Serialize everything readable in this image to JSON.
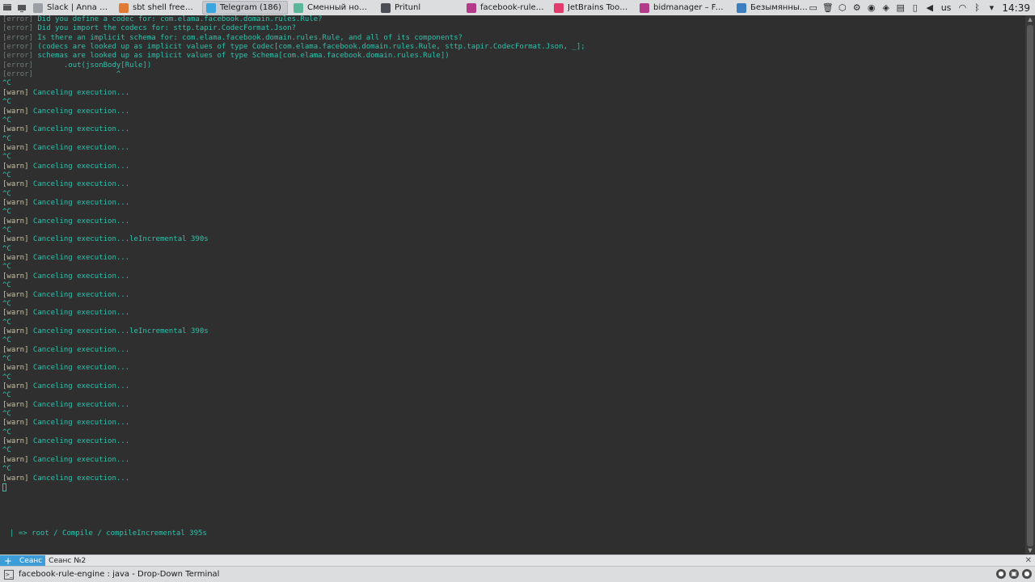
{
  "taskbar": {
    "tasks": [
      {
        "label": "Slack | Anna Pono…",
        "color": "#9aa0a6"
      },
      {
        "label": "sbt shell freeze …",
        "color": "#e07a35"
      },
      {
        "label": "Telegram (186)",
        "color": "#3aa6dd"
      },
      {
        "label": "Сменный носител…",
        "color": "#5bb69a"
      },
      {
        "label": "Pritunl",
        "color": "#4b4f55"
      },
      {
        "label": "facebook-rule-engi…",
        "color": "#b43a8a"
      },
      {
        "label": "JetBrains Toolbox",
        "color": "#e53b6b"
      },
      {
        "label": "bidmanager – Face…",
        "color": "#b43a8a"
      },
      {
        "label": "Безымянный* — S…",
        "color": "#3c7fc1"
      }
    ],
    "lang": "us",
    "clock": "14:39"
  },
  "terminal": {
    "error_lines": [
      {
        "tag": "[error]",
        "text": " Did you define a codec for: com.elama.facebook.domain.rules.Rule?"
      },
      {
        "tag": "[error]",
        "text": " Did you import the codecs for: sttp.tapir.CodecFormat.Json?"
      },
      {
        "tag": "[error]",
        "text": " Is there an implicit schema for: com.elama.facebook.domain.rules.Rule, and all of its components?"
      },
      {
        "tag": "[error]",
        "text": " (codecs are looked up as implicit values of type Codec[com.elama.facebook.domain.rules.Rule, sttp.tapir.CodecFormat.Json, _];"
      },
      {
        "tag": "[error]",
        "text": " schemas are looked up as implicit values of type Schema[com.elama.facebook.domain.rules.Rule])"
      },
      {
        "tag": "[error]",
        "text": "       .out(jsonBody[Rule])"
      },
      {
        "tag": "[error]",
        "text": "                   ^"
      }
    ],
    "interrupt": "^C",
    "warn_tag": "[warn]",
    "warn_lines": [
      " Canceling execution...",
      " Canceling execution...",
      " Canceling execution...",
      " Canceling execution...",
      " Canceling execution...",
      " Canceling execution...",
      " Canceling execution...",
      " Canceling execution...",
      " Canceling execution...leIncremental 390s",
      " Canceling execution...",
      " Canceling execution...",
      " Canceling execution...",
      " Canceling execution...",
      " Canceling execution...leIncremental 390s",
      " Canceling execution...",
      " Canceling execution...",
      " Canceling execution...",
      " Canceling execution...",
      " Canceling execution...",
      " Canceling execution...",
      " Canceling execution...",
      " Canceling execution..."
    ],
    "status": "| => root / Compile / compileIncremental 395s"
  },
  "tabs": [
    {
      "label": "Сеанс",
      "active": true
    },
    {
      "label": "Сеанс №2",
      "active": false
    }
  ],
  "window": {
    "title": "facebook-rule-engine : java - Drop-Down Terminal"
  }
}
